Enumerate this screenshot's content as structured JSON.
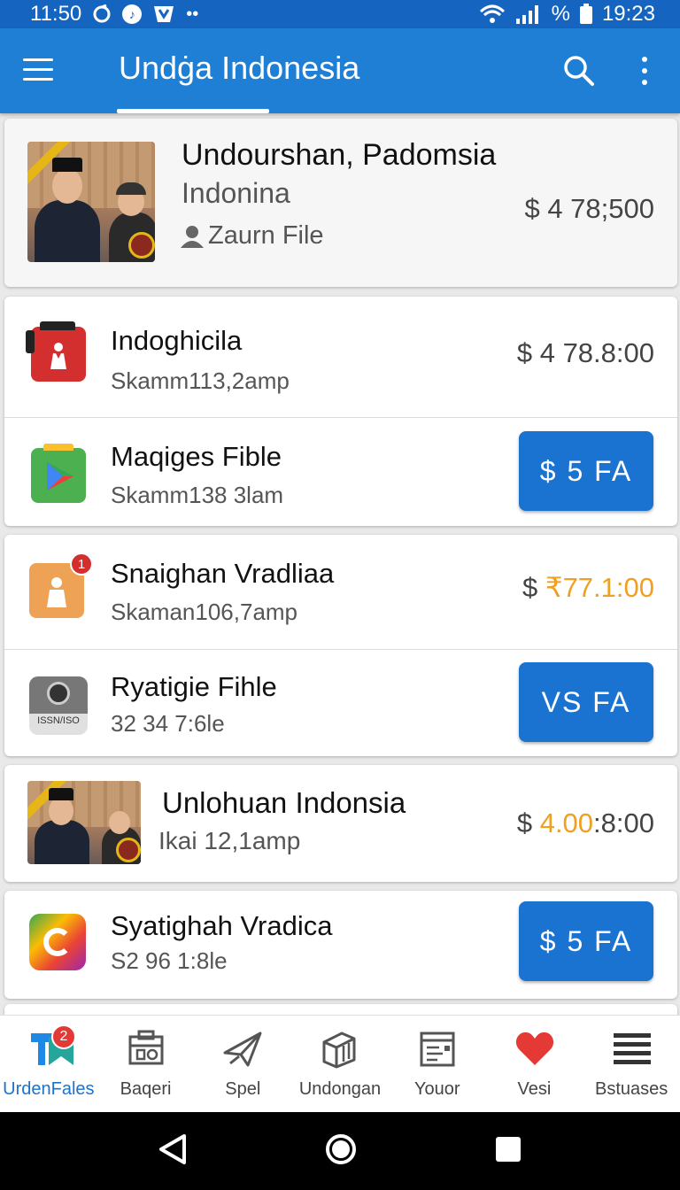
{
  "status_bar": {
    "time_left": "11:50",
    "battery_text": "%",
    "time_right": "19:23"
  },
  "app_bar": {
    "title": "Undġa Indonesia"
  },
  "featured": {
    "title": "Undourshan, Padomsia",
    "subtitle": "Indonina",
    "meta": "Zaurn File",
    "price": "$ 4 78;500"
  },
  "items": [
    {
      "title": "Indoghicila",
      "subtitle": "Skamm113,2amp",
      "price": "$ 4 78.8:00",
      "icon": "red-bag-icon"
    },
    {
      "title": "Maqiges Fible",
      "subtitle": "Skamm138 3lam",
      "button": "$ 5 FA",
      "icon": "play-store-icon"
    },
    {
      "title": "Snaighan Vradliaa",
      "subtitle": "Skaman106,7amp",
      "price_prefix": "$ ",
      "price_highlight": "₹77.1:00",
      "icon": "orange-bag-icon",
      "badge": "1"
    },
    {
      "title": "Ryatigie Fihle",
      "subtitle": "32 34 7:6le",
      "button": "VS FA",
      "icon": "camera-icon",
      "icon_label": "ISSN/ISO"
    },
    {
      "title": "Unlohuan Indonsia",
      "subtitle": "Ikai 12,1amp",
      "price_prefix": "$ ",
      "price_highlight": "4.00",
      "price_suffix": ":8:00",
      "icon": "photo-thumbnail"
    },
    {
      "title": "Syatighah Vradica",
      "subtitle": "S2 96 1:8le",
      "button": "$ 5 FA",
      "icon": "colorful-app-icon"
    }
  ],
  "bottom_nav": [
    {
      "label": "UrdenFales",
      "icon": "bookmark-app-icon",
      "badge": "2",
      "active": true
    },
    {
      "label": "Baqeri",
      "icon": "calendar-box-icon"
    },
    {
      "label": "Spel",
      "icon": "paper-plane-icon"
    },
    {
      "label": "Undongan",
      "icon": "building-icon"
    },
    {
      "label": "Youor",
      "icon": "document-icon"
    },
    {
      "label": "Vesi",
      "icon": "heart-icon"
    },
    {
      "label": "Bstuases",
      "icon": "list-icon"
    }
  ],
  "colors": {
    "primary": "#1e7fd4",
    "status_bar": "#1565c0",
    "button": "#1a73d0",
    "highlight": "#f0a020",
    "heart": "#e53935"
  }
}
